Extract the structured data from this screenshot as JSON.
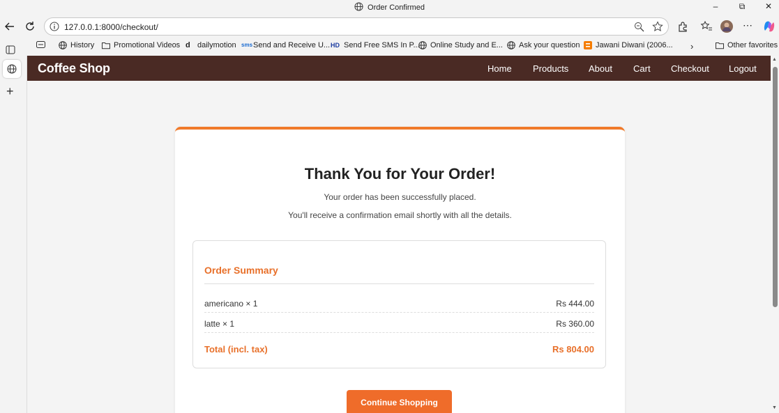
{
  "window": {
    "title": "Order Confirmed"
  },
  "address": {
    "url": "127.0.0.1:8000/checkout/"
  },
  "favorites": [
    {
      "label": "History",
      "icon": "globe-icon"
    },
    {
      "label": "Promotional Videos",
      "icon": "folder-icon"
    },
    {
      "label": "dailymotion",
      "icon": "dailymotion-icon"
    },
    {
      "label": "Send and Receive U...",
      "icon": "sms-icon"
    },
    {
      "label": "Send Free SMS In P...",
      "icon": "hd-icon"
    },
    {
      "label": "Online Study and E...",
      "icon": "globe-icon"
    },
    {
      "label": "Ask your question",
      "icon": "globe-icon"
    },
    {
      "label": "Jawani Diwani (2006...",
      "icon": "blogger-icon"
    }
  ],
  "other_favorites": "Other favorites",
  "site": {
    "brand": "Coffee Shop",
    "nav": [
      "Home",
      "Products",
      "About",
      "Cart",
      "Checkout",
      "Logout"
    ]
  },
  "confirmation": {
    "heading": "Thank You for Your Order!",
    "line1": "Your order has been successfully placed.",
    "line2": "You'll receive a confirmation email shortly with all the details.",
    "summary_title": "Order Summary",
    "items": [
      {
        "name": "americano × 1",
        "price": "Rs 444.00"
      },
      {
        "name": "latte × 1",
        "price": "Rs 360.00"
      }
    ],
    "total_label": "Total (incl. tax)",
    "total_value": "Rs 804.00",
    "button": "Continue Shopping"
  },
  "colors": {
    "navbar": "#4a2a24",
    "accent": "#ef6c2a"
  }
}
